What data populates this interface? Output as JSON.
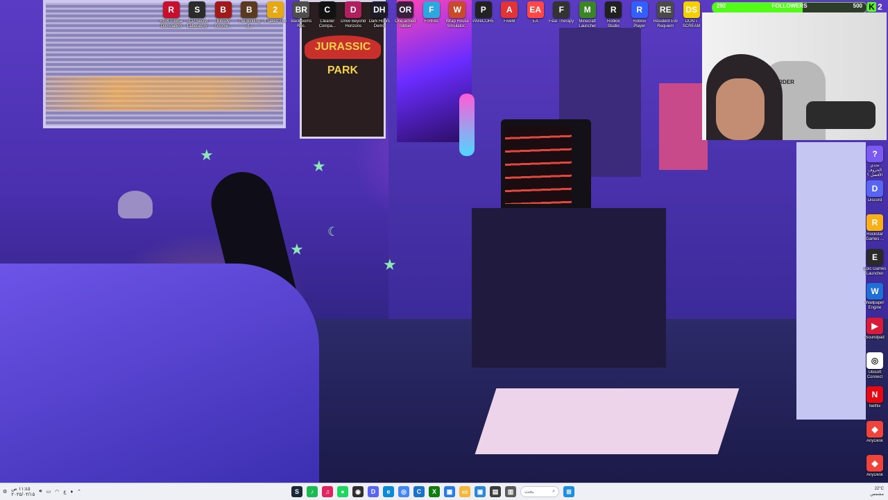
{
  "desktop_icons_top": [
    {
      "label": "RISK Global Domination",
      "icon": "risk-icon",
      "color": "#c8102e",
      "glyph": "R"
    },
    {
      "label": "SCP Secret Laboratory",
      "icon": "scp-icon",
      "color": "#2b2b2b",
      "glyph": "S"
    },
    {
      "label": "Bloody Gnome...",
      "icon": "gnome-icon",
      "color": "#a01a1a",
      "glyph": "B"
    },
    {
      "label": "The Binding of...",
      "icon": "binding-icon",
      "color": "#5a3b22",
      "glyph": "B"
    },
    {
      "label": "It Takes Two",
      "icon": "it-takes-two-icon",
      "color": "#e6a817",
      "glyph": "2"
    },
    {
      "label": "Backrooms Rec.",
      "icon": "backrooms-icon",
      "color": "#4e4e4e",
      "glyph": "BR"
    },
    {
      "label": "Cleaner Compa...",
      "icon": "cleaner-icon",
      "color": "#121212",
      "glyph": "C"
    },
    {
      "label": "Drive Beyond Horizons",
      "icon": "drive-icon",
      "color": "#b0205e",
      "glyph": "D"
    },
    {
      "label": "Dark Hours Demo",
      "icon": "dark-hours-icon",
      "color": "#1c1c2a",
      "glyph": "DH"
    },
    {
      "label": "One-armed robber",
      "icon": "robber-icon",
      "color": "#3a1f3f",
      "glyph": "OR"
    },
    {
      "label": "Fortnite",
      "icon": "fortnite-icon",
      "color": "#2ea7e0",
      "glyph": "F"
    },
    {
      "label": "Wrap House Simulator...",
      "icon": "wrap-house-icon",
      "color": "#c94a2a",
      "glyph": "W"
    },
    {
      "label": "PANICORE",
      "icon": "panicore-icon",
      "color": "#222222",
      "glyph": "P"
    },
    {
      "label": "FiveM",
      "icon": "fivem-icon",
      "color": "#e13438",
      "glyph": "A"
    },
    {
      "label": "EA",
      "icon": "ea-icon",
      "color": "#ff4747",
      "glyph": "EA"
    },
    {
      "label": "Fear Therapy",
      "icon": "fear-therapy-icon",
      "color": "#333333",
      "glyph": "F"
    },
    {
      "label": "Minecraft Launcher",
      "icon": "minecraft-icon",
      "color": "#3c8527",
      "glyph": "M"
    },
    {
      "label": "Roblox Studio",
      "icon": "roblox-studio-icon",
      "color": "#202020",
      "glyph": "R"
    },
    {
      "label": "Roblox Player",
      "icon": "roblox-player-icon",
      "color": "#335fff",
      "glyph": "R"
    },
    {
      "label": "Resident Evil Requiem",
      "icon": "resident-evil-icon",
      "color": "#4a4a4a",
      "glyph": "RE"
    },
    {
      "label": "DON'T SCREAM",
      "icon": "dont-scream-icon",
      "color": "#f4d000",
      "glyph": "DS"
    }
  ],
  "desktop_icons_right": [
    {
      "label": "تحدي الحروف الأفضل ؟",
      "icon": "letters-challenge-icon",
      "color": "#7a5af0",
      "glyph": "?"
    },
    {
      "label": "Discord",
      "icon": "discord-icon",
      "color": "#5865f2",
      "glyph": "D"
    },
    {
      "label": "Rockstar Games ...",
      "icon": "rockstar-icon",
      "color": "#f8b016",
      "glyph": "R"
    },
    {
      "label": "Epic Games Launcher",
      "icon": "epic-games-icon",
      "color": "#2a2a2a",
      "glyph": "E"
    },
    {
      "label": "Wallpaper Engine",
      "icon": "wallpaper-engine-icon",
      "color": "#1f6fd6",
      "glyph": "W"
    },
    {
      "label": "Soundpad",
      "icon": "soundpad-icon",
      "color": "#d81b3a",
      "glyph": "▶"
    },
    {
      "label": "Ubisoft Connect",
      "icon": "ubisoft-icon",
      "color": "#ffffff",
      "glyph": "◎"
    },
    {
      "label": "Netflix",
      "icon": "netflix-icon",
      "color": "#e50914",
      "glyph": "N"
    },
    {
      "label": "AnyDesk",
      "icon": "anydesk-icon",
      "color": "#ef443b",
      "glyph": "◆"
    },
    {
      "label": "AnyDesk",
      "icon": "anydesk-icon",
      "color": "#ef443b",
      "glyph": "◆"
    }
  ],
  "overlay": {
    "followers_label": "FOLLOWERS",
    "followers_current": "292",
    "followers_goal": "500",
    "followers_progress": 0.584,
    "kick_logo": "K",
    "kick_count": "2",
    "accent_color": "#53fc18"
  },
  "webcam": {
    "chair_brand": "LERDER"
  },
  "wallpaper": {
    "poster_title": "JURASSIC PARK"
  },
  "taskbar": {
    "left_time": "١١:٤٥ ص",
    "left_date": "٢٠٢٥/٠٢/١٥",
    "lang": "ع",
    "search_placeholder": "بحث",
    "weather_temp": "22°C",
    "weather_desc": "مشمس",
    "center_icons": [
      {
        "icon": "steam-icon",
        "color": "#1b2838",
        "glyph": "S"
      },
      {
        "icon": "spotify-small-icon",
        "color": "#1db954",
        "glyph": "♪"
      },
      {
        "icon": "app-icon",
        "color": "#e0245e",
        "glyph": "♫"
      },
      {
        "icon": "spotify-icon",
        "color": "#1ed760",
        "glyph": "●"
      },
      {
        "icon": "obs-icon",
        "color": "#302e31",
        "glyph": "◉"
      },
      {
        "icon": "discord-taskbar-icon",
        "color": "#5865f2",
        "glyph": "D"
      },
      {
        "icon": "edge-icon",
        "color": "#0c8ad8",
        "glyph": "e"
      },
      {
        "icon": "chrome-icon",
        "color": "#4285f4",
        "glyph": "◎"
      },
      {
        "icon": "teams-icon",
        "color": "#1a73c8",
        "glyph": "C"
      },
      {
        "icon": "xbox-icon",
        "color": "#107c10",
        "glyph": "X"
      },
      {
        "icon": "store-icon",
        "color": "#2c7be5",
        "glyph": "▦"
      },
      {
        "icon": "file-explorer-icon",
        "color": "#f3b83b",
        "glyph": "▭"
      },
      {
        "icon": "photos-icon",
        "color": "#2b88d8",
        "glyph": "▣"
      },
      {
        "icon": "capture-icon",
        "color": "#3d3d3d",
        "glyph": "▤"
      },
      {
        "icon": "task-view-icon",
        "color": "#5b5b5b",
        "glyph": "▥"
      }
    ]
  }
}
